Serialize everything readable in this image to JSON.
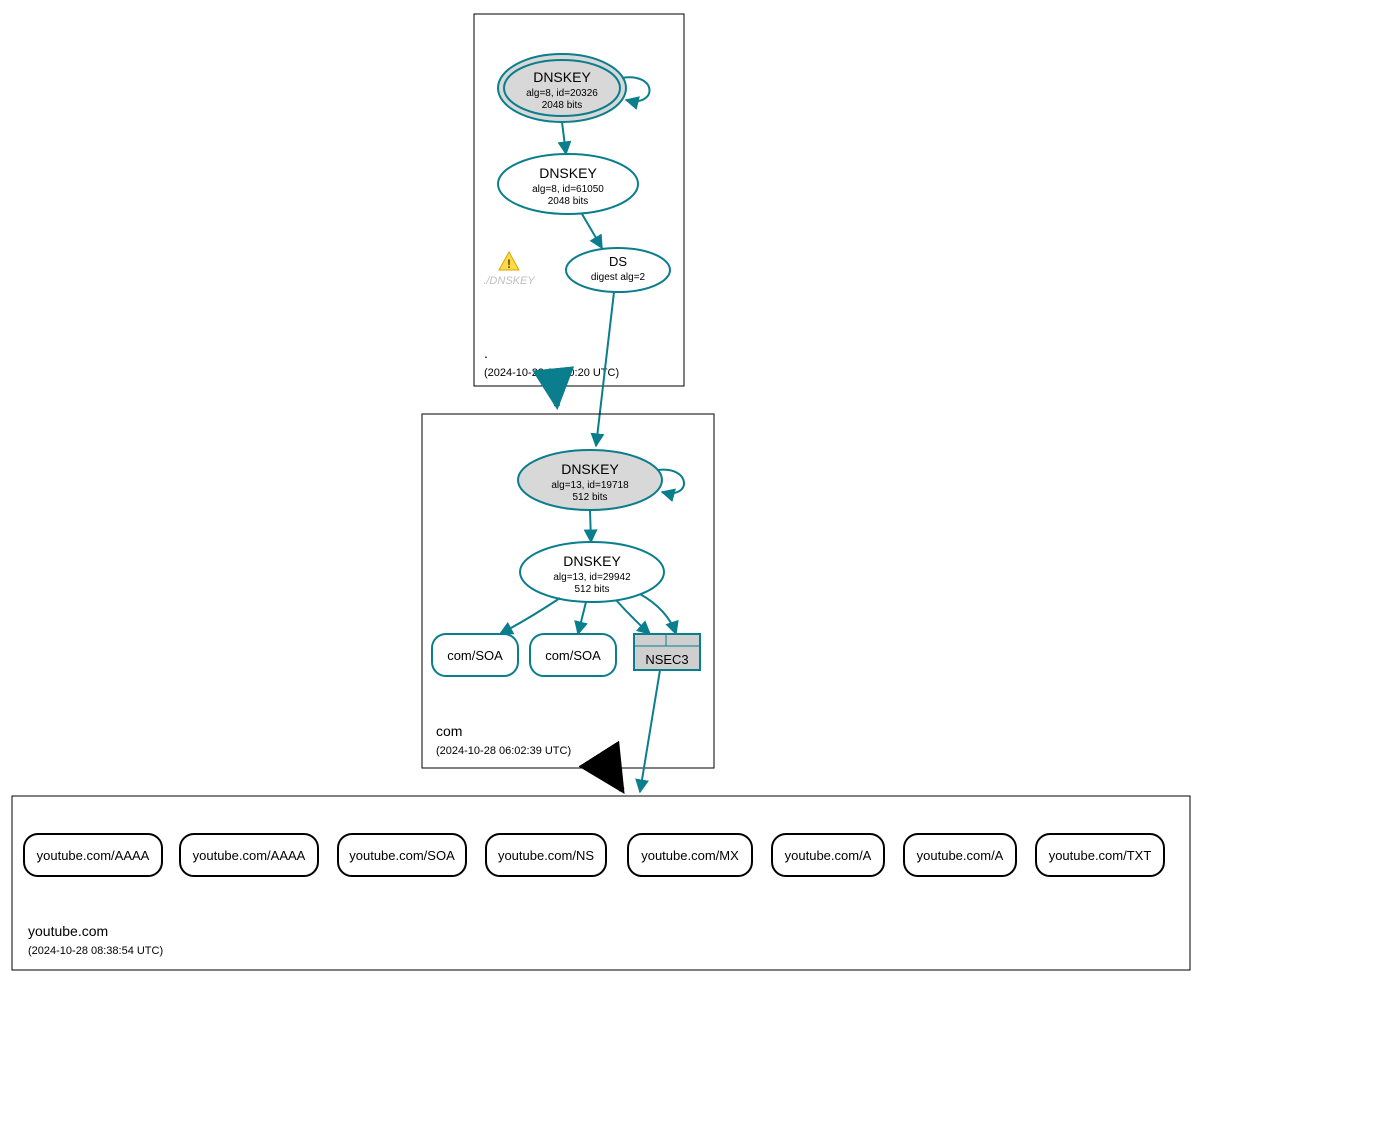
{
  "zones": {
    "root": {
      "name": ".",
      "timestamp": "(2024-10-28 06:00:20 UTC)",
      "dnskey_ksk": {
        "title": "DNSKEY",
        "line1": "alg=8, id=20326",
        "line2": "2048 bits"
      },
      "dnskey_zsk": {
        "title": "DNSKEY",
        "line1": "alg=8, id=61050",
        "line2": "2048 bits"
      },
      "ds": {
        "title": "DS",
        "line1": "digest alg=2"
      },
      "warn_label": "./DNSKEY"
    },
    "com": {
      "name": "com",
      "timestamp": "(2024-10-28 06:02:39 UTC)",
      "dnskey_ksk": {
        "title": "DNSKEY",
        "line1": "alg=13, id=19718",
        "line2": "512 bits"
      },
      "dnskey_zsk": {
        "title": "DNSKEY",
        "line1": "alg=13, id=29942",
        "line2": "512 bits"
      },
      "soa1": "com/SOA",
      "soa2": "com/SOA",
      "nsec3": "NSEC3"
    },
    "leaf": {
      "name": "youtube.com",
      "timestamp": "(2024-10-28 08:38:54 UTC)",
      "records": [
        "youtube.com/AAAA",
        "youtube.com/AAAA",
        "youtube.com/SOA",
        "youtube.com/NS",
        "youtube.com/MX",
        "youtube.com/A",
        "youtube.com/A",
        "youtube.com/TXT"
      ]
    }
  },
  "colors": {
    "teal": "#0a7e8c",
    "fill_grey": "#d8d8d8",
    "nsec_fill": "#cfcfcf",
    "warn_text": "#bfbfbf"
  }
}
